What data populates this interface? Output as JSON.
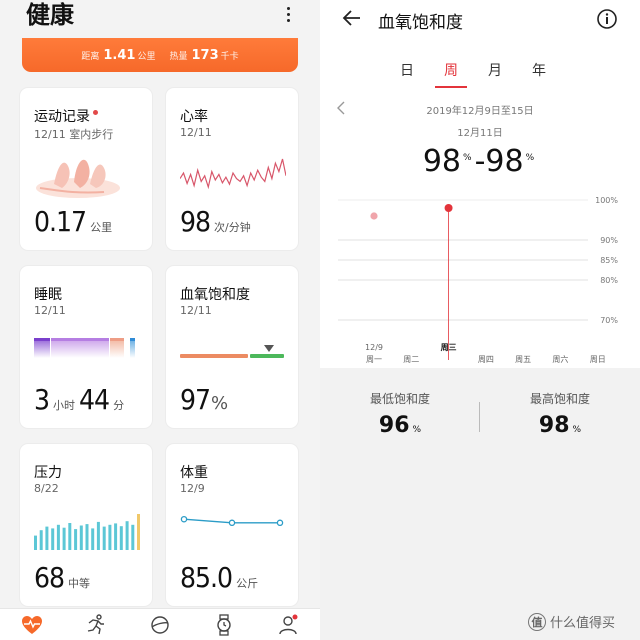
{
  "health": {
    "title": "健康",
    "summary": {
      "distance_label": "距离",
      "distance_value": "1.41",
      "distance_unit": "公里",
      "calories_label": "热量",
      "calories_value": "173",
      "calories_unit": "千卡"
    },
    "cards": {
      "exercise": {
        "title": "运动记录",
        "date": "12/11 室内步行",
        "value": "0.17",
        "unit": "公里"
      },
      "heart_rate": {
        "title": "心率",
        "date": "12/11",
        "value": "98",
        "unit": "次/分钟",
        "values": [
          62,
          70,
          55,
          68,
          52,
          74,
          58,
          66,
          50,
          72,
          60,
          68,
          56,
          64,
          54,
          70,
          62,
          58,
          66,
          52,
          70,
          60,
          74,
          64,
          58,
          78,
          62,
          84,
          72,
          90,
          66
        ]
      },
      "sleep": {
        "title": "睡眠",
        "date": "12/11",
        "hours": "3",
        "hours_unit": "小时",
        "minutes": "44",
        "minutes_unit": "分"
      },
      "spo2": {
        "title": "血氧饱和度",
        "date": "12/11",
        "value": "97",
        "unit": "%"
      },
      "stress": {
        "title": "压力",
        "date": "8/22",
        "value": "68",
        "unit": "中等",
        "values": [
          40,
          55,
          65,
          60,
          70,
          62,
          75,
          58,
          68,
          72,
          60,
          78,
          65,
          70,
          74,
          66,
          80,
          70,
          100
        ]
      },
      "weight": {
        "title": "体重",
        "date": "12/9",
        "value": "85.0",
        "unit": "公斤",
        "values": [
          85.3,
          85.0,
          85.0
        ]
      }
    },
    "tabs": [
      "health",
      "exercise",
      "discover",
      "device",
      "me"
    ]
  },
  "spo2_page": {
    "title": "血氧饱和度",
    "periods": [
      "日",
      "周",
      "月",
      "年"
    ],
    "active_period": "周",
    "range": "2019年12月9日至15日",
    "selected_day": "12月11日",
    "reading_low": "98",
    "reading_high": "98",
    "reading_unit": "%",
    "chart_data": {
      "type": "scatter",
      "x_date_label": "12/9",
      "categories": [
        "周一",
        "周二",
        "周三",
        "周四",
        "周五",
        "周六",
        "周日"
      ],
      "selected_category": "周三",
      "y_ticks": [
        "100%",
        "90%",
        "85%",
        "80%",
        "70%"
      ],
      "points": [
        {
          "category": "周一",
          "value": 96
        },
        {
          "category": "周三",
          "value": 98
        }
      ]
    },
    "min_label": "最低饱和度",
    "min_value": "96",
    "max_label": "最高饱和度",
    "max_value": "98",
    "stat_unit": "%"
  },
  "watermark": {
    "badge": "值",
    "text": "什么值得买"
  },
  "colors": {
    "accent_orange": "#f6692a",
    "accent_red": "#e3343b",
    "heart_line": "#d8566a",
    "stress_bar": "#5cc7d6",
    "weight_line": "#2b9cc7"
  }
}
